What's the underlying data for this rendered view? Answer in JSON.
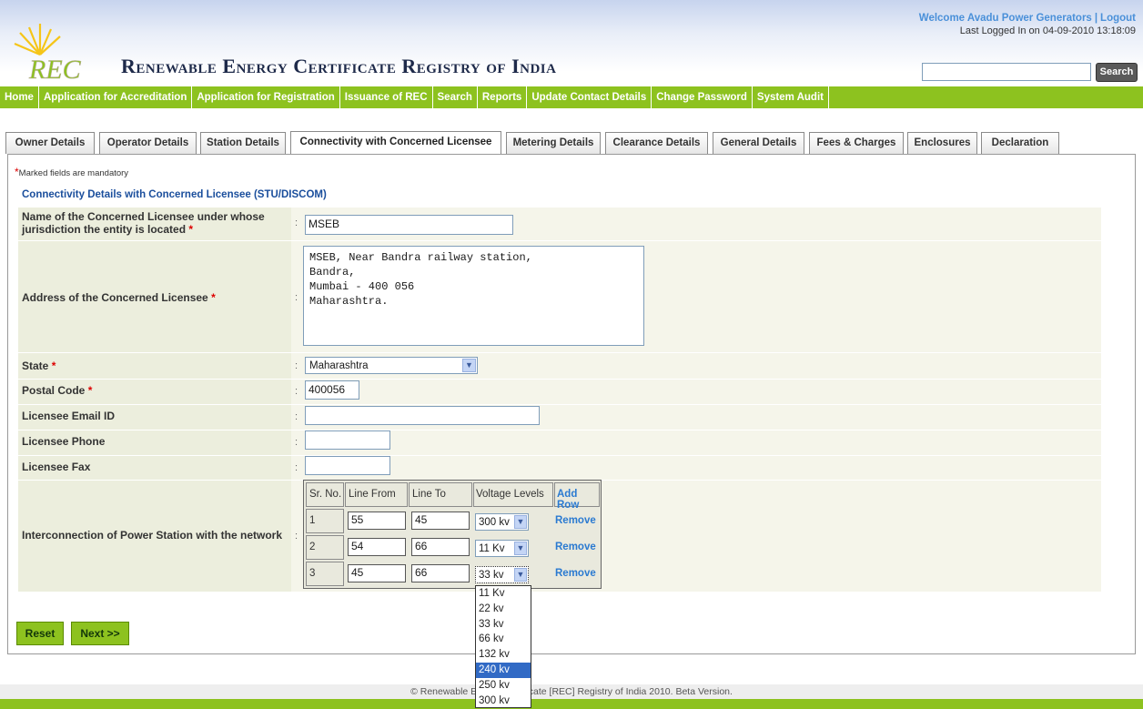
{
  "header": {
    "welcome": "Welcome Avadu Power Generators",
    "separator": "|",
    "logout": "Logout",
    "last_login": "Last Logged In on 04-09-2010 13:18:09",
    "logo_text": "REC",
    "brand": "Renewable Energy Certificate Registry of India",
    "search_value": "",
    "search_button": "Search"
  },
  "nav": {
    "items": [
      "Home",
      "Application for Accreditation",
      "Application for Registration",
      "Issuance of REC",
      "Search",
      "Reports",
      "Update Contact Details",
      "Change Password",
      "System Audit"
    ]
  },
  "tabs": [
    "Owner Details",
    "Operator Details",
    "Station Details",
    "Connectivity with Concerned Licensee",
    "Metering Details",
    "Clearance Details",
    "General Details",
    "Fees & Charges",
    "Enclosures",
    "Declaration"
  ],
  "active_tab": "Connectivity with Concerned Licensee",
  "form": {
    "mandatory_note": "Marked fields are mandatory",
    "section_title": "Connectivity Details with Concerned Licensee (STU/DISCOM)",
    "licensee_name_label_1": "Name of the Concerned Licensee under whose",
    "licensee_name_label_2": "jurisdiction the entity is located",
    "licensee_name_value": "MSEB",
    "address_label": "Address of the Concerned Licensee",
    "address_lines": [
      "MSEB, Near Bandra railway station,",
      "Bandra,",
      "Mumbai - 400 056",
      "Maharashtra."
    ],
    "state_label": "State",
    "state_value": "Maharashtra",
    "postal_label": "Postal Code",
    "postal_value": "400056",
    "email_label": "Licensee Email ID",
    "email_value": "",
    "phone_label": "Licensee Phone",
    "phone_value": "",
    "fax_label": "Licensee Fax",
    "fax_value": "",
    "interconnection_label": "Interconnection of Power Station with the network",
    "colon": ":",
    "required_mark": "*"
  },
  "interconnection": {
    "headers": [
      "Sr. No.",
      "Line From",
      "Line To",
      "Voltage Levels"
    ],
    "add_row": "Add Row",
    "remove": "Remove",
    "rows": [
      {
        "sr": "1",
        "from": "55",
        "to": "45",
        "voltage": "300 kv"
      },
      {
        "sr": "2",
        "from": "54",
        "to": "66",
        "voltage": "11 Kv"
      },
      {
        "sr": "3",
        "from": "45",
        "to": "66",
        "voltage": "33 kv"
      }
    ],
    "dropdown_options": [
      "11 Kv",
      "22 kv",
      "33 kv",
      "66 kv",
      "132 kv",
      "240 kv",
      "250 kv",
      "300 kv"
    ],
    "dropdown_highlighted": "240 kv"
  },
  "buttons": {
    "reset": "Reset",
    "next": "Next >>"
  },
  "footer": {
    "text": "© Renewable Energy Certificate [REC] Registry of India 2010. Beta Version."
  },
  "colors": {
    "nav_green": "#8dc21f",
    "link_blue": "#2a7ad1",
    "required_red": "#dd0000",
    "row_bg": "#eceedd"
  }
}
